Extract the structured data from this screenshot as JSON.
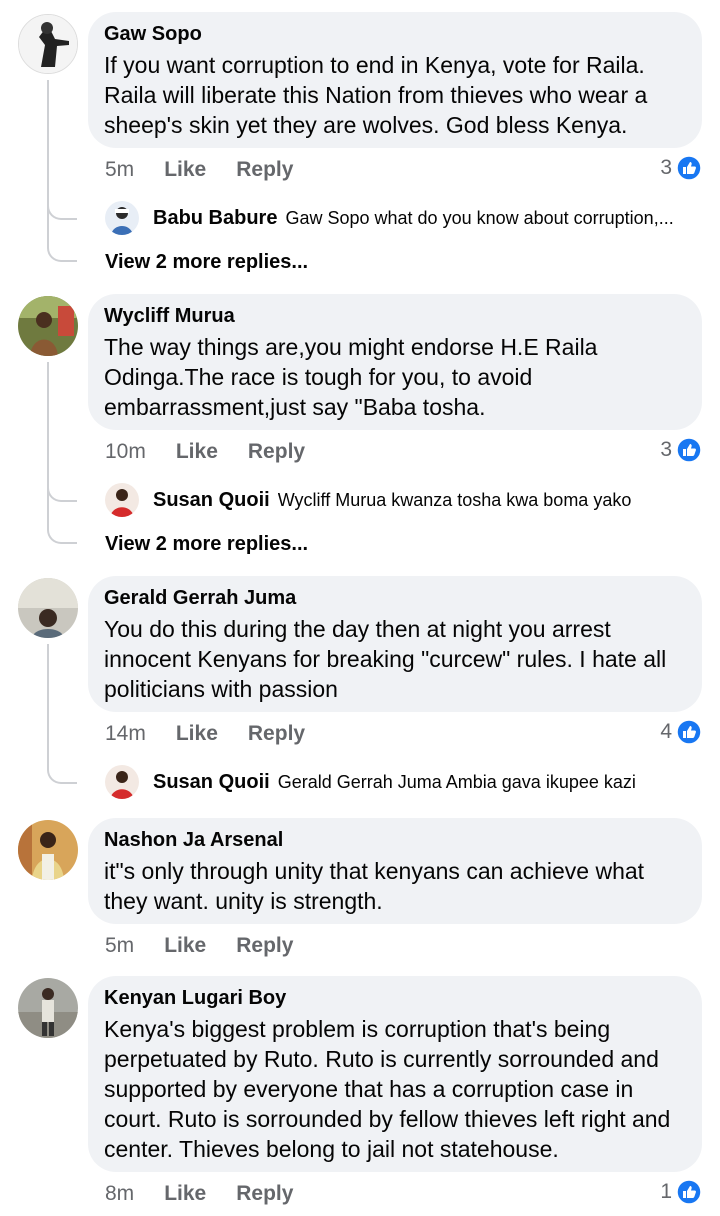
{
  "comments": [
    {
      "author": "Gaw Sopo",
      "text": "If you want corruption to end in Kenya, vote for Raila. Raila will liberate this Nation from thieves who wear a sheep's skin yet they are wolves. God bless Kenya.",
      "time": "5m",
      "like_label": "Like",
      "reply_label": "Reply",
      "reactions": "3",
      "reply": {
        "author": "Babu Babure",
        "text": "Gaw Sopo what do you know about corruption,..."
      },
      "more_replies": "View 2 more replies..."
    },
    {
      "author": "Wycliff Murua",
      "text": "The way things are,you might endorse H.E Raila Odinga.The race is tough for you, to avoid embarrassment,just say \"Baba tosha.",
      "time": "10m",
      "like_label": "Like",
      "reply_label": "Reply",
      "reactions": "3",
      "reply": {
        "author": "Susan Quoii",
        "text": "Wycliff Murua kwanza tosha kwa boma yako"
      },
      "more_replies": "View 2 more replies..."
    },
    {
      "author": "Gerald Gerrah Juma",
      "text": "You do this during the day then at  night you arrest innocent Kenyans for breaking \"curcew\" rules. I hate all politicians with passion",
      "time": "14m",
      "like_label": "Like",
      "reply_label": "Reply",
      "reactions": "4",
      "reply": {
        "author": "Susan Quoii",
        "text": "Gerald Gerrah Juma Ambia gava ikupee kazi"
      }
    },
    {
      "author": "Nashon Ja Arsenal",
      "text": "it\"s only through unity that kenyans can achieve what they want. unity is strength.",
      "time": "5m",
      "like_label": "Like",
      "reply_label": "Reply"
    },
    {
      "author": "Kenyan Lugari Boy",
      "text": "Kenya's biggest problem is corruption that's being perpetuated by Ruto. Ruto is currently sorrounded and supported by everyone that has a corruption case in court. Ruto is sorrounded by fellow thieves left right and center. Thieves belong to jail not statehouse.",
      "time": "8m",
      "like_label": "Like",
      "reply_label": "Reply",
      "reactions": "1"
    }
  ],
  "colors": {
    "bubble": "#f0f2f5",
    "secondary_text": "#65676b",
    "like_blue": "#1877f2",
    "thread_line": "#ced0d4"
  },
  "icons": {
    "reaction": "like-thumbs-up-icon"
  }
}
